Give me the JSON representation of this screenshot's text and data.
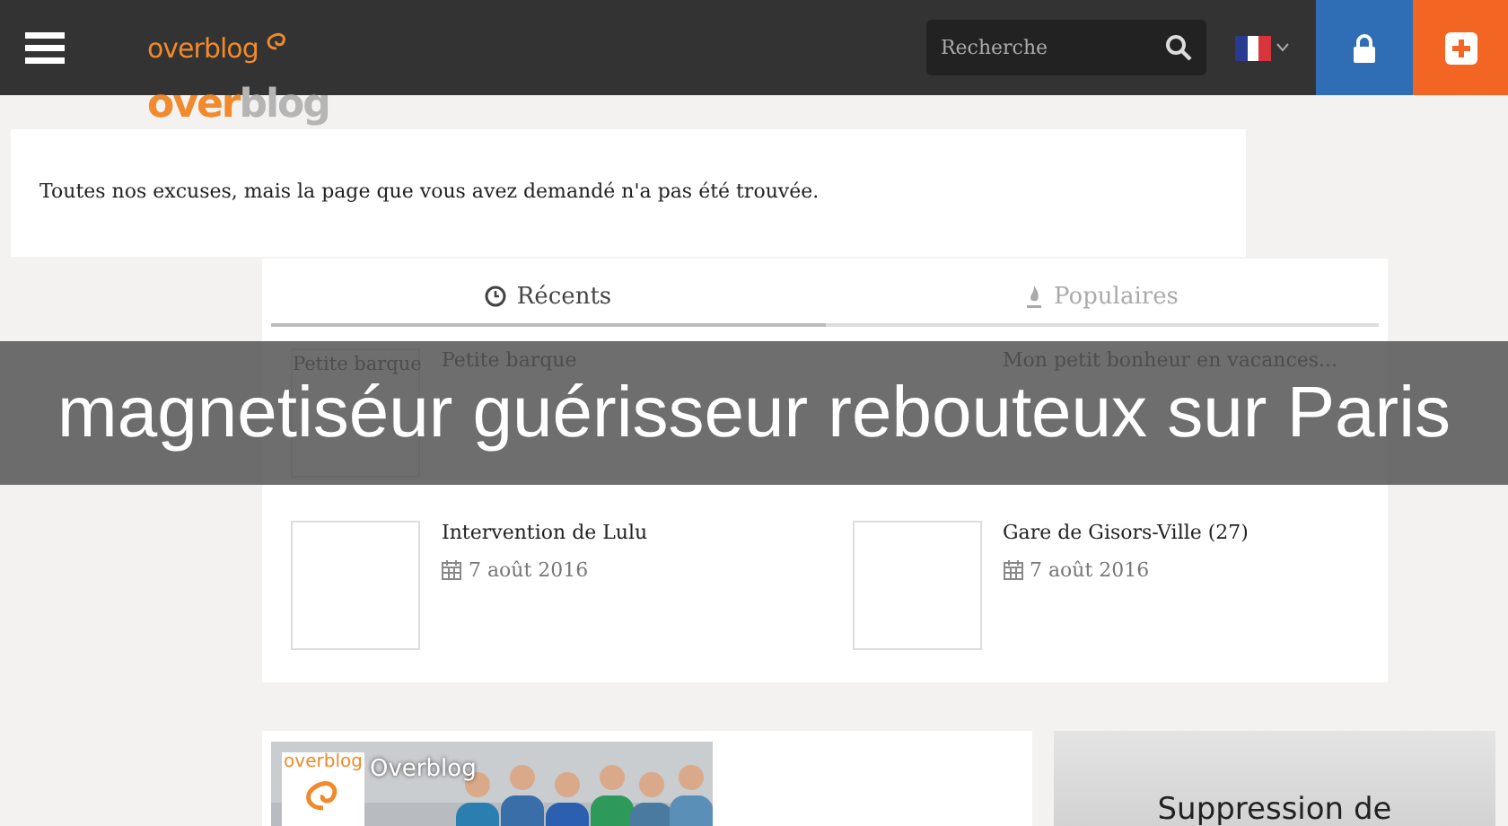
{
  "header": {
    "logo": "overblog",
    "search": {
      "placeholder": "Recherche"
    }
  },
  "ghost_logo": {
    "left": "over",
    "right": "blog"
  },
  "message": "Toutes nos excuses, mais la page que vous avez demandé n'a pas été trouvée.",
  "tabs": [
    {
      "label": "Récents",
      "selected": true,
      "kind": "clock"
    },
    {
      "label": "Populaires",
      "selected": false,
      "kind": "flame"
    }
  ],
  "articles": [
    {
      "title": "Petite barque",
      "thumb_alt": "Petite barque"
    },
    {
      "title": "Mon petit bonheur en vacances..."
    },
    {
      "title": "Intervention de Lulu",
      "date": "7 août 2016"
    },
    {
      "title": "Gare de Gisors-Ville (27)",
      "date": "7 août 2016"
    }
  ],
  "facebook": {
    "logo": "overblog",
    "name": "Overblog"
  },
  "ad": {
    "text": "Suppression de"
  },
  "banner": "magnetiséur guérisseur rebouteux sur Paris"
}
